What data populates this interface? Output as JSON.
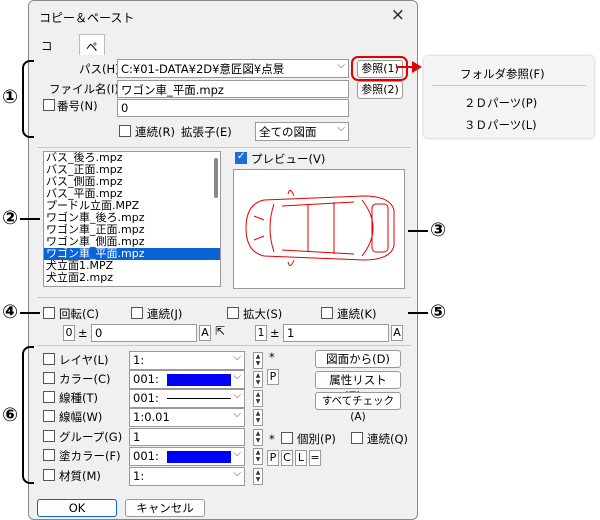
{
  "window": {
    "title": "コピー＆ペースト",
    "close_icon": "×"
  },
  "tabs": [
    {
      "label": "コピー"
    },
    {
      "label": "ペースト"
    }
  ],
  "path": {
    "label": "パス(H)",
    "value": "C:¥01-DATA¥2D¥意匠図¥点景",
    "browse1": "参照(1)",
    "browse2": "参照(2)"
  },
  "filename": {
    "label": "ファイル名(I)",
    "value": "ワゴン車_平面.mpz"
  },
  "number": {
    "label": "番号(N)",
    "value": "0"
  },
  "sequence": {
    "label": "連続(R)"
  },
  "extension": {
    "label": "拡張子(E)",
    "value": "全ての図面"
  },
  "files": [
    "バス_後ろ.mpz",
    "バス_正面.mpz",
    "バス_側面.mpz",
    "バス_平面.mpz",
    "プードル立面.MPZ",
    "ワゴン車_後ろ.mpz",
    "ワゴン車_正面.mpz",
    "ワゴン車_側面.mpz",
    "ワゴン車_平面.mpz",
    "犬立面1.MPZ",
    "犬立面2.mpz"
  ],
  "selected_file_index": 8,
  "preview": {
    "label": "プレビュー(V)"
  },
  "rotate": {
    "label": "回転(C)",
    "seq_label": "連続(J)",
    "angle_num": "0",
    "pm": "±",
    "value": "0",
    "a": "A"
  },
  "scale": {
    "label": "拡大(S)",
    "seq_label": "連続(K)",
    "num": "1",
    "pm": "±",
    "value": "1",
    "a": "A"
  },
  "attributes": [
    {
      "label": "レイヤ(L)",
      "value": "1:"
    },
    {
      "label": "カラー(C)",
      "value": "001:"
    },
    {
      "label": "線種(T)",
      "value": "001:"
    },
    {
      "label": "線幅(W)",
      "value": "1:0.01"
    },
    {
      "label": "グループ(G)",
      "value": "1"
    },
    {
      "label": "塗カラー(F)",
      "value": "001:"
    },
    {
      "label": "材質(M)",
      "value": "1:"
    }
  ],
  "attr_side": {
    "star": "*",
    "p": "P",
    "c": "C",
    "l": "L",
    "eq": "=",
    "individual": "個別(P)",
    "seq": "連続(Q)"
  },
  "right_buttons": [
    "図面から(D)",
    "属性リスト(Z)...",
    "すべてチェック(A)"
  ],
  "buttons": {
    "ok": "OK",
    "cancel": "キャンセル"
  },
  "popup_menu": [
    "フォルダ参照(F)",
    "２Ｄパーツ(P)",
    "３Ｄパーツ(L)"
  ],
  "markers": [
    "①",
    "②",
    "③",
    "④",
    "⑤",
    "⑥"
  ],
  "colors": {
    "blue_swatch": "#0000ff",
    "highlight": "#e00000",
    "selection": "#0a64d6"
  }
}
